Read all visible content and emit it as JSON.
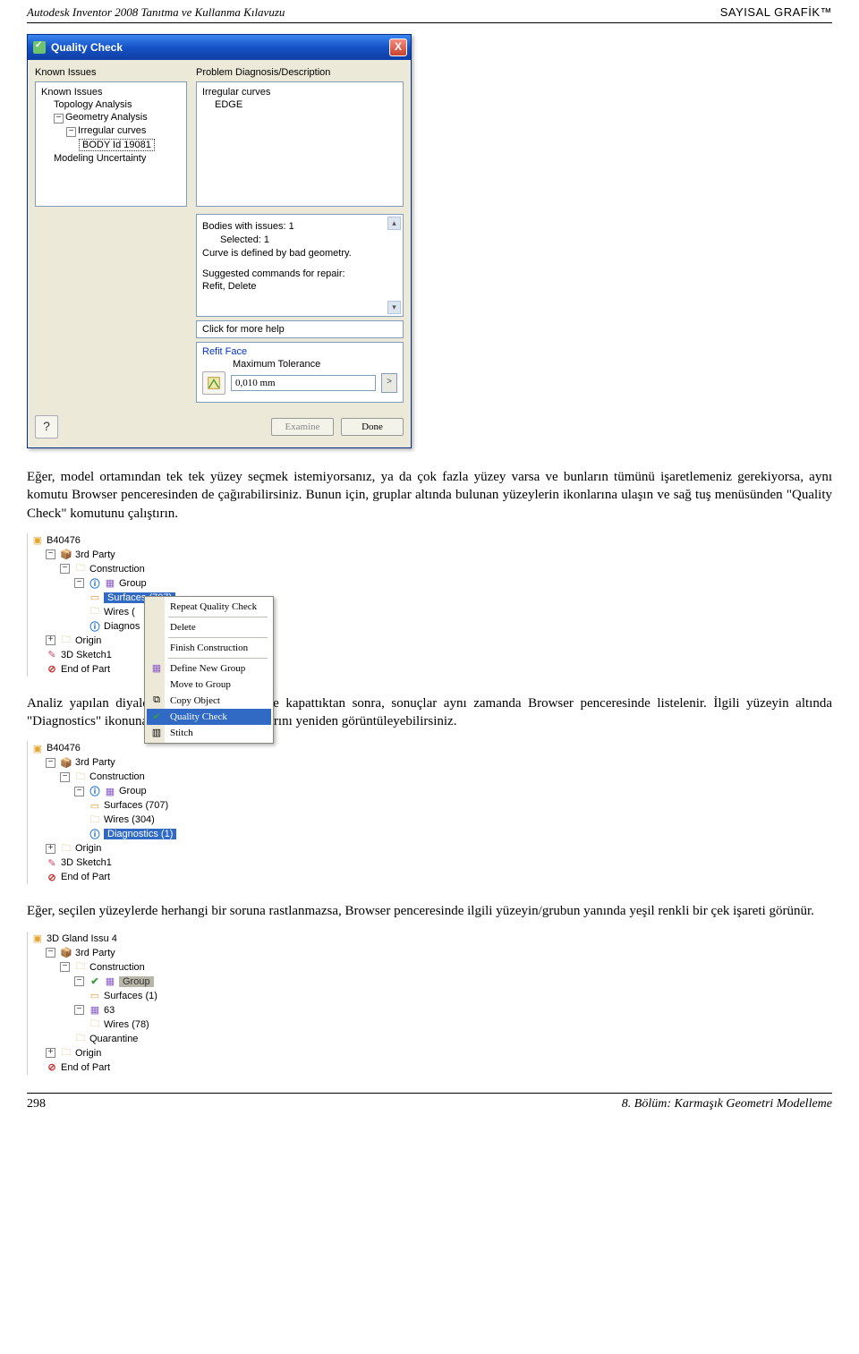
{
  "header": {
    "left": "Autodesk Inventor 2008 Tanıtma ve Kullanma Kılavuzu",
    "right": "SAYISAL GRAFİK™"
  },
  "dialog": {
    "title": "Quality Check",
    "close": "X",
    "left_header": "Known Issues",
    "right_header": "Problem Diagnosis/Description",
    "known_issues": {
      "root": "Known Issues",
      "topo": "Topology Analysis",
      "geom": "Geometry Analysis",
      "irreg": "Irregular curves",
      "body": "BODY Id 19081",
      "model": "Modeling Uncertainty"
    },
    "diag_tree": {
      "root": "Irregular curves",
      "edge": "EDGE"
    },
    "desc": {
      "l1": "Bodies with issues: 1",
      "l2": "Selected: 1",
      "l3": "Curve is defined by bad geometry.",
      "l4": "Suggested commands for repair:",
      "l5": "Refit, Delete"
    },
    "help_link": "Click for more help",
    "refit": {
      "title": "Refit Face",
      "tol_label": "Maximum Tolerance",
      "tol_value": "0,010 mm",
      "spin": ">"
    },
    "examine": "Examine",
    "done": "Done",
    "help_icon": "?"
  },
  "para1": "Eğer, model ortamından tek tek yüzey seçmek istemiyorsanız, ya da çok fazla yüzey varsa ve bunların tümünü işaretlemeniz gerekiyorsa, aynı komutu Browser penceresinden de çağırabilirsiniz. Bunun için, gruplar altında bulunan yüzeylerin ikonlarına ulaşın ve sağ tuş menüsünden \"Quality Check\" komutunu çalıştırın.",
  "browser1": {
    "root": "B40476",
    "thirdparty": "3rd Party",
    "construction": "Construction",
    "group": "Group",
    "surfaces": "Surfaces (707)",
    "wires": "Wires (",
    "diagno": "Diagnos",
    "origin": "Origin",
    "sketch": "3D Sketch1",
    "end": "End of Part"
  },
  "ctx": {
    "repeat": "Repeat Quality Check",
    "delete": "Delete",
    "finish": "Finish Construction",
    "define": "Define New Group",
    "move": "Move to Group",
    "copy": "Copy Object",
    "quality": "Quality Check",
    "stitch": "Stitch"
  },
  "para2": "Analiz yapılan diyalog kutusunu \"Done\" ile kapattıktan sonra, sonuçlar aynı zamanda Browser penceresinde listelenir. İlgili yüzeyin altında \"Diagnostics\" ikonuna çift tıklayarak, sonuçlarını yeniden görüntüleyebilirsiniz.",
  "browser2": {
    "root": "B40476",
    "thirdparty": "3rd Party",
    "construction": "Construction",
    "group": "Group",
    "surfaces": "Surfaces (707)",
    "wires": "Wires (304)",
    "diag": "Diagnostics (1)",
    "origin": "Origin",
    "sketch": "3D Sketch1",
    "end": "End of Part"
  },
  "para3": "Eğer, seçilen yüzeylerde herhangi bir soruna rastlanmazsa, Browser penceresinde ilgili yüzeyin/grubun yanında yeşil renkli bir çek işareti görünür.",
  "browser3": {
    "root": "3D Gland Issu 4",
    "thirdparty": "3rd Party",
    "construction": "Construction",
    "group": "Group",
    "surfaces": "Surfaces (1)",
    "g63": "63",
    "wires": "Wires (78)",
    "quarantine": "Quarantine",
    "origin": "Origin",
    "end": "End of Part"
  },
  "footer": {
    "page": "298",
    "chapter": "8. Bölüm: Karmaşık Geometri Modelleme"
  }
}
